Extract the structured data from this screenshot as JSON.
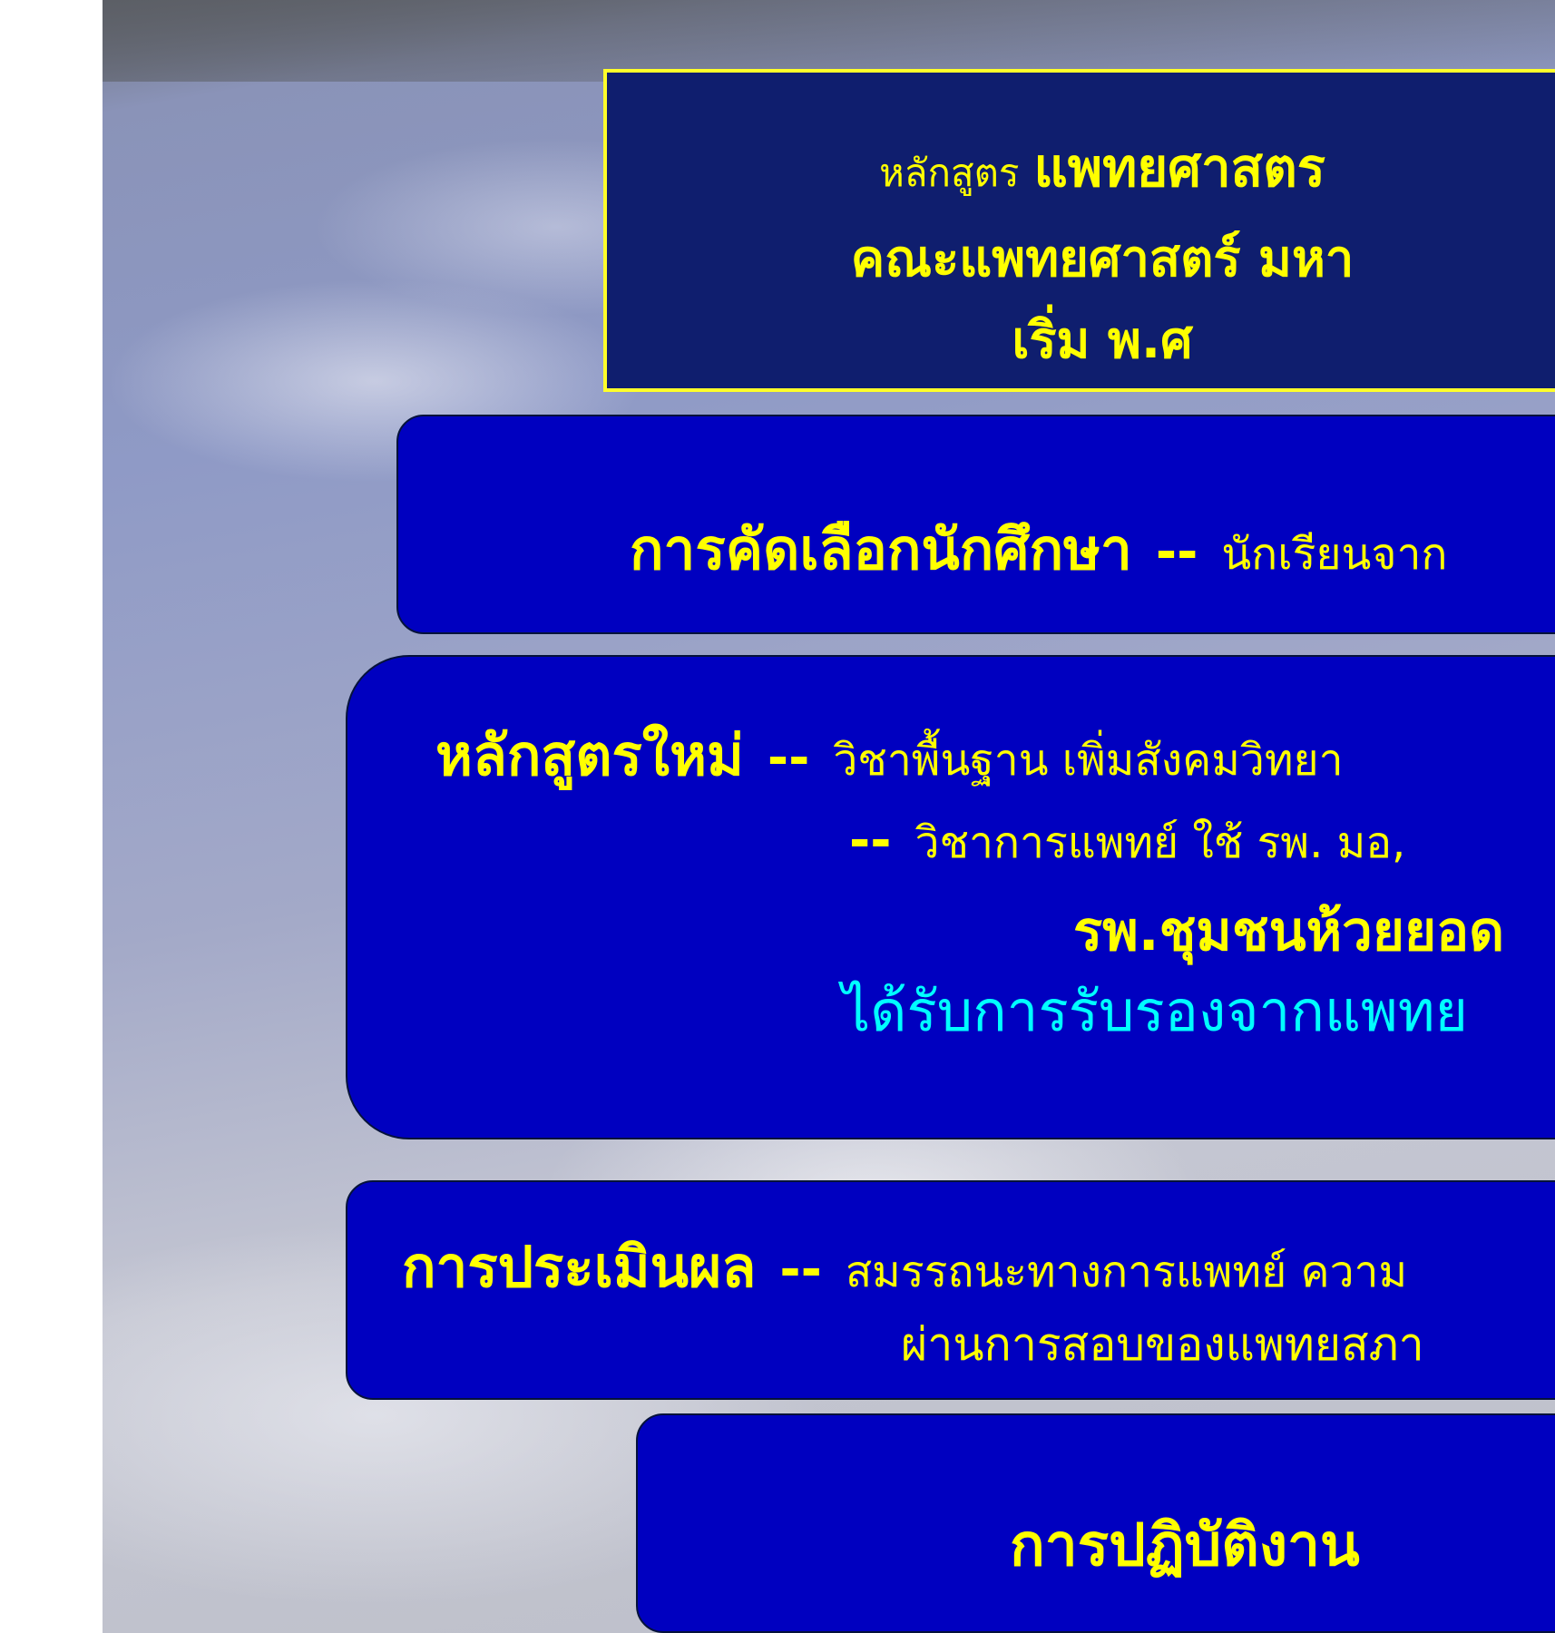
{
  "title": {
    "prefix": "หลักสูตร",
    "main": "แพทยศาสตร",
    "line2": "คณะแพทยศาสตร์ มหา",
    "line3": "เริ่ม พ.ศ"
  },
  "selection": {
    "heading": "การคัดเลือกนักศึกษา",
    "separator": "--",
    "text": "นักเรียนจาก"
  },
  "curriculum": {
    "heading": "หลักสูตรใหม่",
    "separator1": "--",
    "line1_text": "วิชาพื้นฐาน เพิ่มสังคมวิทยา",
    "separator2": "--",
    "line2_text": "วิชาการแพทย์ ใช้  รพ. มอ,",
    "line3": "รพ.ชุมชนห้วยยอด",
    "line4": "ได้รับการรับรองจากแพทย"
  },
  "evaluation": {
    "heading": "การประเมินผล",
    "separator": "--",
    "line1_text": "สมรรถนะทางการแพทย์ ความ",
    "line2": "ผ่านการสอบของแพทยสภา"
  },
  "practice": {
    "heading": "การปฏิบัติงาน"
  },
  "colors": {
    "title_bg": "#0f1e6e",
    "title_border": "#ffff2a",
    "panel_bg": "#0000c0",
    "text_yellow": "#ffff00",
    "text_cyan": "#00ffff"
  }
}
